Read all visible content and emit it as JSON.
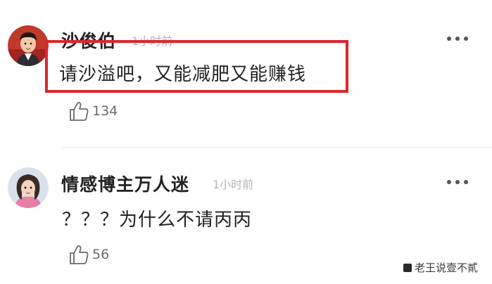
{
  "comments": [
    {
      "username": "沙俊伯",
      "timestamp": "1小时前",
      "text": "请沙溢吧，又能减肥又能赚钱",
      "likes": "134",
      "avatar": "boy-avatar-icon"
    },
    {
      "username": "情感博主万人迷",
      "timestamp": "1小时前",
      "text": "？？？为什么不请丙丙",
      "likes": "56",
      "avatar": "woman-avatar-icon"
    }
  ],
  "watermark": "老王说壹不貳",
  "colors": {
    "highlight_border": "#e0252a",
    "timestamp": "#b5b5b5",
    "text": "#222222"
  }
}
